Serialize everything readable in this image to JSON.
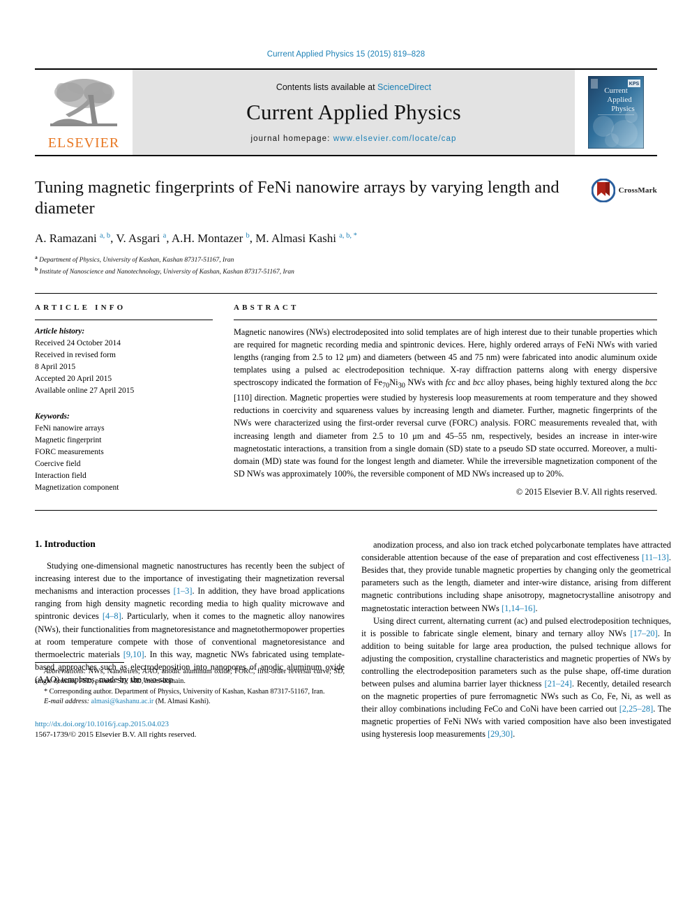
{
  "running_head": "Current Applied Physics 15 (2015) 819–828",
  "masthead": {
    "publisher_name": "ELSEVIER",
    "contents_prefix": "Contents lists available at ",
    "contents_link": "ScienceDirect",
    "journal_title": "Current Applied Physics",
    "homepage_prefix": "journal homepage: ",
    "homepage_url": "www.elsevier.com/locate/cap",
    "cover_title_lines": [
      "Current",
      "Applied",
      "Physics"
    ],
    "cover_badge": "KPS",
    "colors": {
      "link": "#1a7fb5",
      "elsevier_orange": "#e87722",
      "band": "#e3e3e3"
    }
  },
  "article": {
    "title": "Tuning magnetic fingerprints of FeNi nanowire arrays by varying length and diameter",
    "crossmark_label": "CrossMark",
    "authors_html": "A. Ramazani <sup>a, b</sup>, V. Asgari <sup>a</sup>, A.H. Montazer <sup>b</sup>, M. Almasi Kashi <sup>a, b, *</sup>",
    "affiliations": [
      {
        "marker": "a",
        "text": "Department of Physics, University of Kashan, Kashan 87317-51167, Iran"
      },
      {
        "marker": "b",
        "text": "Institute of Nanoscience and Nanotechnology, University of Kashan, Kashan 87317-51167, Iran"
      }
    ]
  },
  "article_info": {
    "heading": "ARTICLE INFO",
    "history_label": "Article history:",
    "history": [
      "Received 24 October 2014",
      "Received in revised form",
      "8 April 2015",
      "Accepted 20 April 2015",
      "Available online 27 April 2015"
    ],
    "keywords_label": "Keywords:",
    "keywords": [
      "FeNi nanowire arrays",
      "Magnetic fingerprint",
      "FORC measurements",
      "Coercive field",
      "Interaction field",
      "Magnetization component"
    ]
  },
  "abstract": {
    "heading": "ABSTRACT",
    "text_html": "Magnetic nanowires (NWs) electrodeposited into solid templates are of high interest due to their tunable properties which are required for magnetic recording media and spintronic devices. Here, highly ordered arrays of FeNi NWs with varied lengths (ranging from 2.5 to 12 &#956;m) and diameters (between 45 and 75 nm) were fabricated into anodic aluminum oxide templates using a pulsed ac electrodeposition technique. X-ray diffraction patterns along with energy dispersive spectroscopy indicated the formation of Fe<sub>70</sub>Ni<sub>30</sub> NWs with <i>fcc</i> and <i>bcc</i> alloy phases, being highly textured along the <i>bcc</i> [110] direction. Magnetic properties were studied by hysteresis loop measurements at room temperature and they showed reductions in coercivity and squareness values by increasing length and diameter. Further, magnetic fingerprints of the NWs were characterized using the first-order reversal curve (FORC) analysis. FORC measurements revealed that, with increasing length and diameter from 2.5 to 10 &#956;m and 45&ndash;55 nm, respectively, besides an increase in inter-wire magnetostatic interactions, a transition from a single domain (SD) state to a pseudo SD state occurred. Moreover, a multi-domain (MD) state was found for the longest length and diameter. While the irreversible magnetization component of the SD NWs was approximately 100%, the reversible component of MD NWs increased up to 20%.",
    "copyright": "© 2015 Elsevier B.V. All rights reserved."
  },
  "introduction": {
    "heading": "1. Introduction",
    "left_paragraphs_html": [
      "Studying one-dimensional magnetic nanostructures has recently been the subject of increasing interest due to the importance of investigating their magnetization reversal mechanisms and interaction processes <span class=\"ref\">[1&ndash;3]</span>. In addition, they have broad applications ranging from high density magnetic recording media to high quality microwave and spintronic devices <span class=\"ref\">[4&ndash;8]</span>. Particularly, when it comes to the magnetic alloy nanowires (NWs), their functionalities from magnetoresistance and magnetothermopower properties at room temperature compete with those of conventional magnetoresistance and thermoelectric materials <span class=\"ref\">[9,10]</span>. In this way, magnetic NWs fabricated using template-based approaches such as electrodeposition into nanopores of anodic aluminum oxide (AAO) templates, made by the two-step"
    ],
    "right_paragraphs_html": [
      "anodization process, and also ion track etched polycarbonate templates have attracted considerable attention because of the ease of preparation and cost effectiveness <span class=\"ref\">[11&ndash;13]</span>. Besides that, they provide tunable magnetic properties by changing only the geometrical parameters such as the length, diameter and inter-wire distance, arising from different magnetic contributions including shape anisotropy, magnetocrystalline anisotropy and magnetostatic interaction between NWs <span class=\"ref\">[1,14&ndash;16]</span>.",
      "Using direct current, alternating current (ac) and pulsed electrodeposition techniques, it is possible to fabricate single element, binary and ternary alloy NWs <span class=\"ref\">[17&ndash;20]</span>. In addition to being suitable for large area production, the pulsed technique allows for adjusting the composition, crystalline characteristics and magnetic properties of NWs by controlling the electrodeposition parameters such as the pulse shape, off-time duration between pulses and alumina barrier layer thickness <span class=\"ref\">[21&ndash;24]</span>. Recently, detailed research on the magnetic properties of pure ferromagnetic NWs such as Co, Fe, Ni, as well as their alloy combinations including FeCo and CoNi have been carried out <span class=\"ref\">[2,25&ndash;28]</span>. The magnetic properties of FeNi NWs with varied composition have also been investigated using hysteresis loop measurements <span class=\"ref\">[29,30]</span>."
    ]
  },
  "footnotes": {
    "abbreviations_html": "<span class=\"it\">Abbreviations:</span> NWs, Nanowires; AAO, anodic aluminum oxide; FORC, first-order reversal curve; SD, single domain; PSD, pseudo SD; MD, multi-domain.",
    "corresponding_html": "* Corresponding author. Department of Physics, University of Kashan, Kashan 87317-51167, Iran.",
    "email_label": "E-mail address:",
    "email": "almasi@kashanu.ac.ir",
    "email_owner": "(M. Almasi Kashi).",
    "doi": "http://dx.doi.org/10.1016/j.cap.2015.04.023",
    "issn_line": "1567-1739/© 2015 Elsevier B.V. All rights reserved."
  }
}
